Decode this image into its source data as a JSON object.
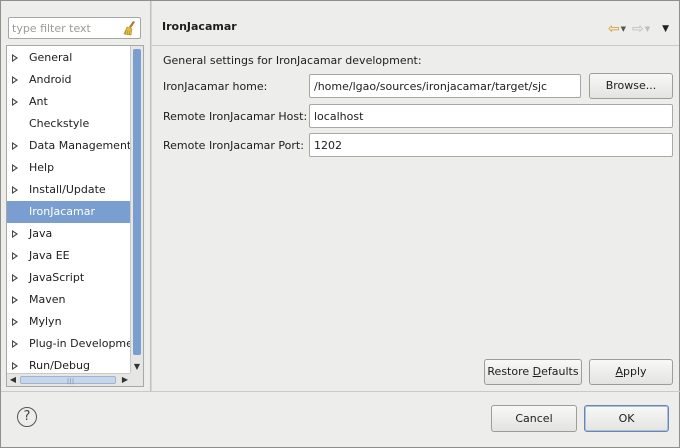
{
  "filter": {
    "placeholder": "type filter text"
  },
  "tree": {
    "items": [
      {
        "label": "General",
        "expandable": true
      },
      {
        "label": "Android",
        "expandable": true
      },
      {
        "label": "Ant",
        "expandable": true
      },
      {
        "label": "Checkstyle",
        "expandable": false
      },
      {
        "label": "Data Management",
        "expandable": true
      },
      {
        "label": "Help",
        "expandable": true
      },
      {
        "label": "Install/Update",
        "expandable": true
      },
      {
        "label": "IronJacamar",
        "expandable": false,
        "selected": true
      },
      {
        "label": "Java",
        "expandable": true
      },
      {
        "label": "Java EE",
        "expandable": true
      },
      {
        "label": "JavaScript",
        "expandable": true
      },
      {
        "label": "Maven",
        "expandable": true
      },
      {
        "label": "Mylyn",
        "expandable": true
      },
      {
        "label": "Plug-in Developme",
        "expandable": true
      },
      {
        "label": "Run/Debug",
        "expandable": true
      }
    ]
  },
  "page": {
    "title": "IronJacamar",
    "intro": "General settings for IronJacamar development:",
    "home_label": "IronJacamar home:",
    "home_value": "/home/lgao/sources/ironjacamar/target/sjc",
    "browse_label": "Browse...",
    "host_label": "Remote IronJacamar Host:",
    "host_value": "localhost",
    "port_label": "Remote IronJacamar Port:",
    "port_value": "1202",
    "restore_pre": "Restore ",
    "restore_ul": "D",
    "restore_post": "efaults",
    "apply_pre": "",
    "apply_ul": "A",
    "apply_post": "pply"
  },
  "footer": {
    "cancel_label": "Cancel",
    "ok_label": "OK",
    "help_glyph": "?"
  },
  "colors": {
    "selection": "#7a9ecf",
    "back_arrow": "#d09a1e"
  },
  "icons": {
    "filter_clear": "broom-icon",
    "back": "arrow-left-icon",
    "forward": "arrow-right-icon",
    "view_menu": "triangle-down-icon",
    "help": "question-circle-icon"
  }
}
